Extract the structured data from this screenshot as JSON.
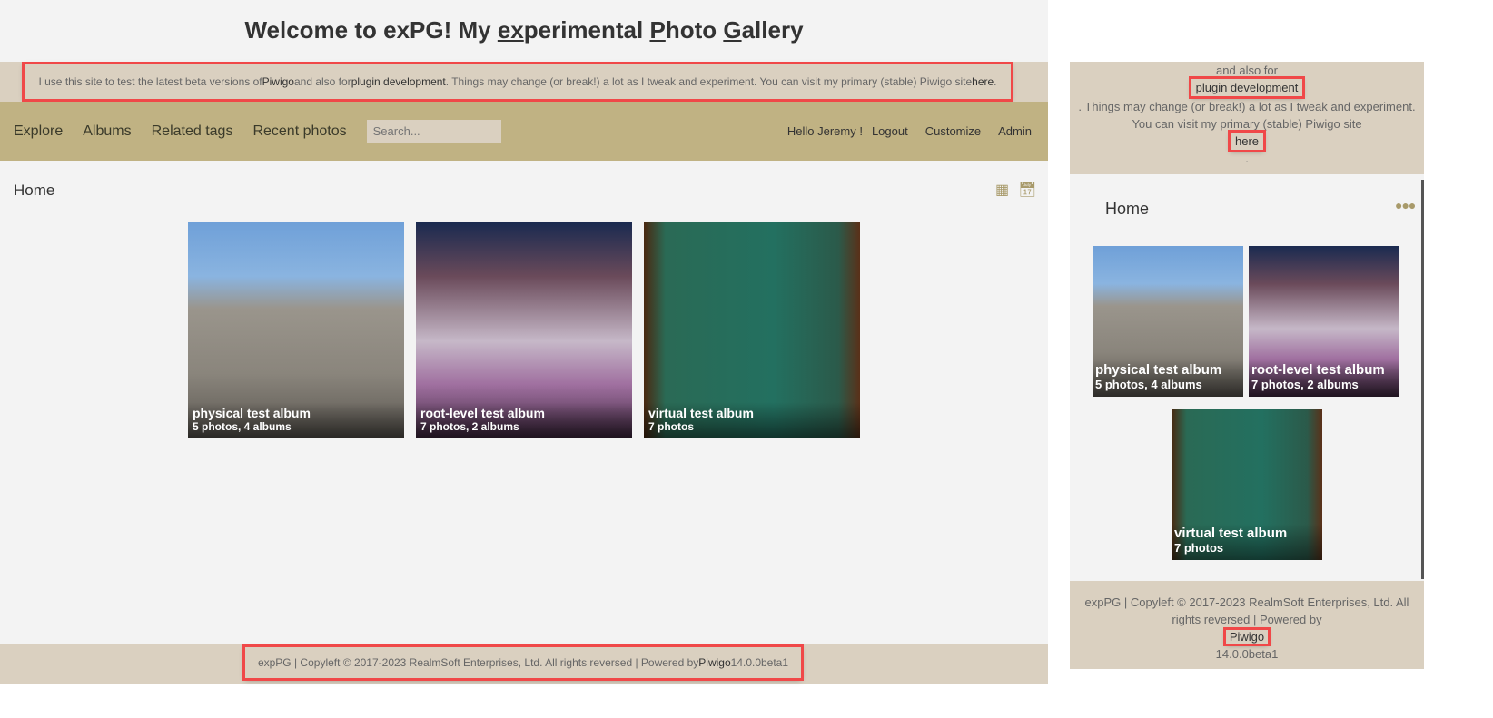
{
  "header": {
    "title_parts": [
      "Welcome to exPG! My ",
      "ex",
      "perimental ",
      "P",
      "hoto ",
      "G",
      "allery"
    ]
  },
  "banner": {
    "pre": "I use this site to test the latest beta versions of ",
    "piwigo": "Piwigo",
    "mid": " and also for ",
    "plugin": "plugin development",
    "post": ". Things may change (or break!) a lot as I tweak and experiment. You can visit my primary (stable) Piwigo site ",
    "here": "here",
    "end": "."
  },
  "nav": {
    "items": [
      "Explore",
      "Albums",
      "Related tags",
      "Recent photos"
    ],
    "search_placeholder": "Search...",
    "greeting": "Hello Jeremy !",
    "logout": "Logout",
    "customize": "Customize",
    "admin": "Admin"
  },
  "main": {
    "breadcrumb": "Home",
    "icons": [
      "grid-icon",
      "calendar-icon"
    ]
  },
  "albums": [
    {
      "name": "physical test album",
      "count": "5 photos, 4 albums"
    },
    {
      "name": "root-level test album",
      "count": "7 photos, 2 albums"
    },
    {
      "name": "virtual test album",
      "count": "7 photos"
    }
  ],
  "footer": {
    "text": "expPG | Copyleft © 2017-2023 RealmSoft Enterprises, Ltd. All rights reversed | Powered by ",
    "piwigo": "Piwigo",
    "version": " 14.0.0beta1"
  },
  "mobile": {
    "banner_line1": "and also for",
    "banner_line2": ". Things may change (or break!) a lot as I tweak and experiment. You can visit my primary (stable) Piwigo site",
    "banner_end": ".",
    "footer_text": "expPG | Copyleft © 2017-2023 RealmSoft Enterprises, Ltd. All rights reversed | Powered by",
    "footer_version": "14.0.0beta1"
  },
  "colors": {
    "banner": "#dad0c0",
    "nav": "#c0b283",
    "highlight": "#f04848"
  }
}
